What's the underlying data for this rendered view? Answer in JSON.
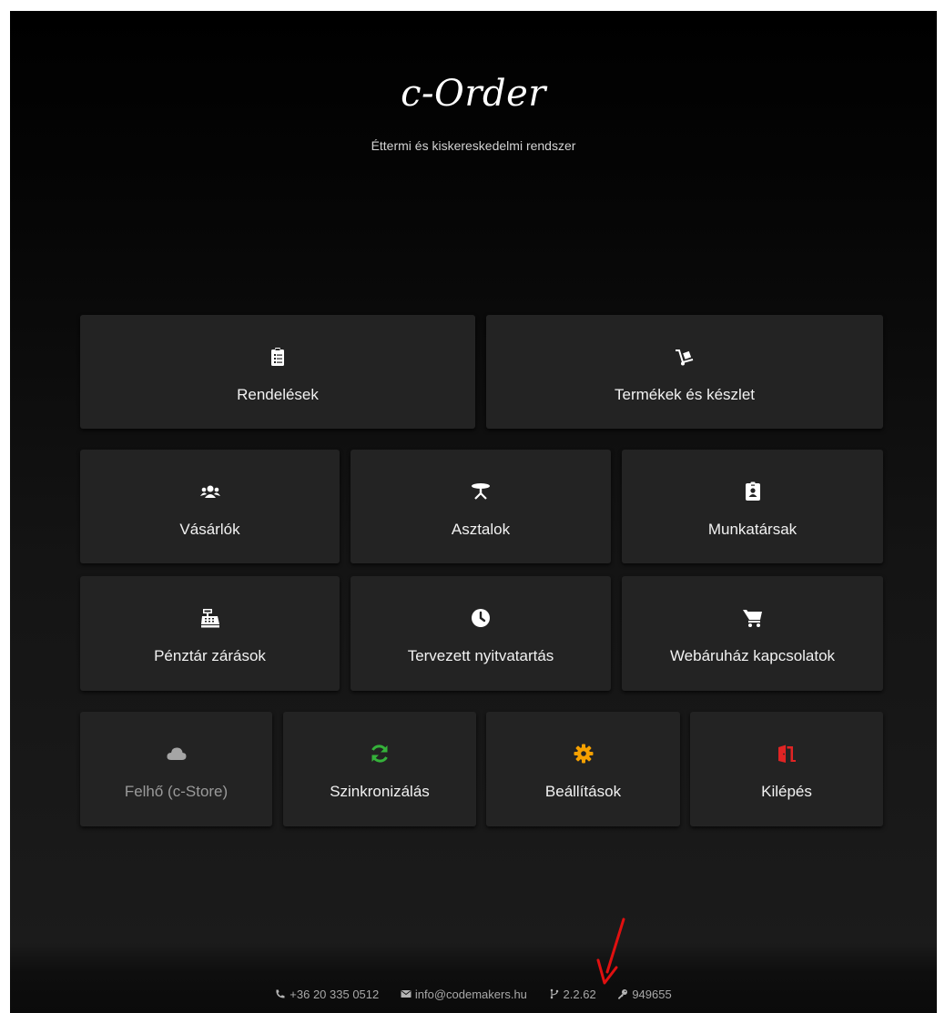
{
  "header": {
    "logo": "c-Order",
    "tagline": "Éttermi és kiskereskedelmi rendszer"
  },
  "menu": [
    {
      "label": "Rendelések",
      "icon": "clipboard-list-icon"
    },
    {
      "label": "Termékek és készlet",
      "icon": "dolly-icon"
    },
    {
      "label": "Vásárlók",
      "icon": "users-icon"
    },
    {
      "label": "Asztalok",
      "icon": "table-icon"
    },
    {
      "label": "Munkatársak",
      "icon": "id-badge-icon"
    },
    {
      "label": "Pénztár zárások",
      "icon": "cash-register-icon"
    },
    {
      "label": "Tervezett nyitvatartás",
      "icon": "clock-icon"
    },
    {
      "label": "Webáruház kapcsolatok",
      "icon": "cart-icon"
    },
    {
      "label": "Felhő (c-Store)",
      "icon": "cloud-icon",
      "disabled": true
    },
    {
      "label": "Szinkronizálás",
      "icon": "sync-icon"
    },
    {
      "label": "Beállítások",
      "icon": "gear-icon"
    },
    {
      "label": "Kilépés",
      "icon": "exit-door-icon"
    }
  ],
  "footer": {
    "phone": "+36 20 335 0512",
    "email": "info@codemakers.hu",
    "version": "2.2.62",
    "license": "949655"
  },
  "colors": {
    "background": "#111111",
    "tile": "#232323",
    "text": "#f2f2f2",
    "disabled_text": "#9a9a9a",
    "sync_icon": "#35b23a",
    "gear_icon": "#f5a000",
    "exit_icon": "#e02424",
    "annotation_arrow": "#e01010"
  }
}
